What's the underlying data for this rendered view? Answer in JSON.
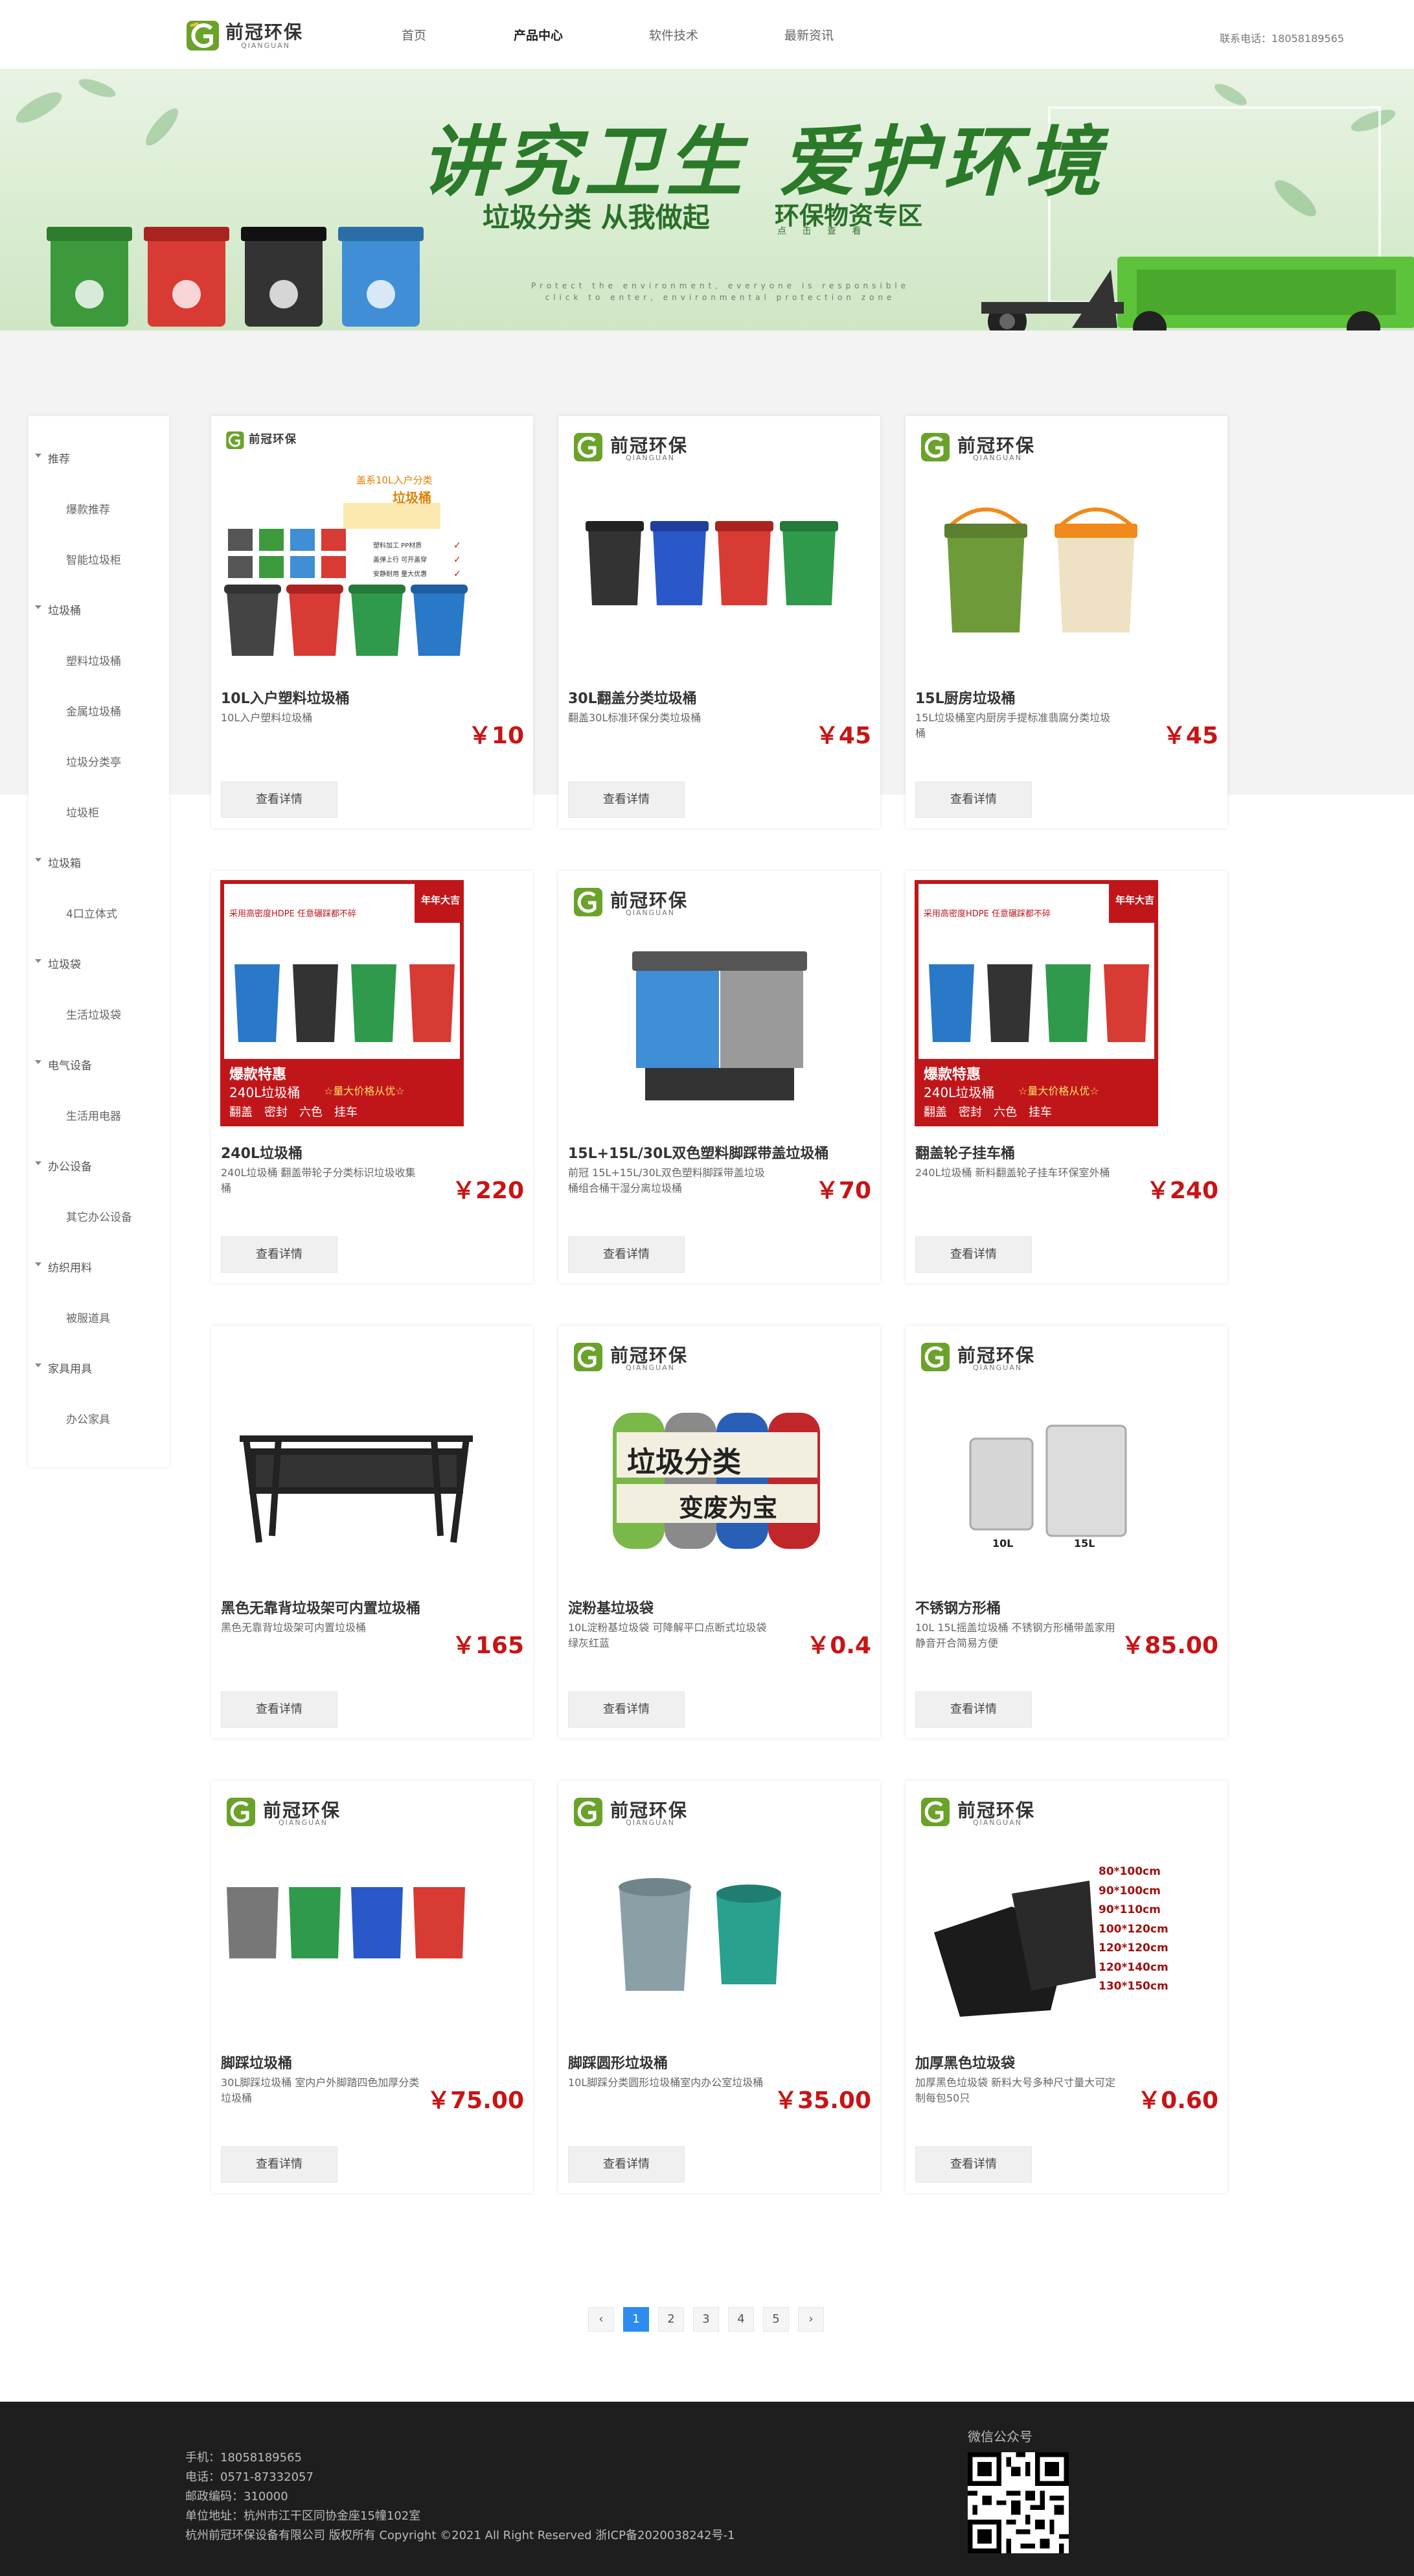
{
  "header": {
    "logo_cn": "前冠环保",
    "logo_en": "QIANGUAN",
    "nav": [
      "首页",
      "产品中心",
      "软件技术",
      "最新资讯"
    ],
    "active_nav": "产品中心",
    "phone": "联系电话：18058189565"
  },
  "banner": {
    "title": "讲究卫生 爱护环境",
    "sub1": "垃圾分类 从我做起",
    "sub2": "环保物资专区",
    "sub2_small": "点 击 查 看",
    "en_line1": "Protect the environment, everyone is responsible",
    "en_line2": "click to enter, environmental protection zone"
  },
  "sidebar": {
    "groups": [
      {
        "label": "推荐",
        "items": [
          "爆款推荐",
          "智能垃圾柜"
        ]
      },
      {
        "label": "垃圾桶",
        "items": [
          "塑料垃圾桶",
          "金属垃圾桶",
          "垃圾分类亭",
          "垃圾柜"
        ]
      },
      {
        "label": "垃圾箱",
        "items": [
          "4口立体式"
        ]
      },
      {
        "label": "垃圾袋",
        "items": [
          "生活垃圾袋"
        ]
      },
      {
        "label": "电气设备",
        "items": [
          "生活用电器"
        ]
      },
      {
        "label": "办公设备",
        "items": [
          "其它办公设备"
        ]
      },
      {
        "label": "纺织用料",
        "items": [
          "被服道具"
        ]
      },
      {
        "label": "家具用具",
        "items": [
          "办公家具"
        ]
      }
    ]
  },
  "products": [
    {
      "name": "10L入户塑料垃圾桶",
      "desc": "10L入户塑料垃圾桶",
      "price": "￥10",
      "button": "查看详情",
      "img_logo": "前冠环保",
      "img_caption1": "盖系10L入户分类",
      "img_caption2": "垃圾桶",
      "img_features": [
        "塑料加工 PP材质",
        "盖弹上行 可开盖穿",
        "安静耐用 量大优惠"
      ]
    },
    {
      "name": "30L翻盖分类垃圾桶",
      "desc": "翻盖30L标准环保分类垃圾桶",
      "price": "￥45",
      "button": "查看详情",
      "img_logo": "前冠环保"
    },
    {
      "name": "15L厨房垃圾桶",
      "desc": "15L垃圾桶室内厨房手提标准翡腐分类垃圾桶",
      "price": "￥45",
      "button": "查看详情",
      "img_logo": "前冠环保"
    },
    {
      "name": "240L垃圾桶",
      "desc": "240L垃圾桶 翻盖带轮子分类标识垃圾收集桶",
      "price": "￥220",
      "button": "查看详情",
      "img_badge": "年年大吉",
      "img_text1": "采用高密度HDPE 任意碾踩都不碎",
      "img_promo": "爆款特惠",
      "img_size": "240L垃圾桶",
      "img_deal": "☆量大价格从优☆",
      "img_tags": [
        "翻盖",
        "密封",
        "六色",
        "挂车"
      ]
    },
    {
      "name": "15L+15L/30L双色塑料脚踩带盖垃圾桶",
      "desc": "前冠 15L+15L/30L双色塑料脚踩带盖垃圾桶组合桶干湿分离垃圾桶",
      "price": "￥70",
      "button": "查看详情",
      "img_logo": "前冠环保"
    },
    {
      "name": "翻盖轮子挂车桶",
      "desc": "240L垃圾桶 新料翻盖轮子挂车环保室外桶",
      "price": "￥240",
      "button": "查看详情",
      "img_badge": "年年大吉",
      "img_text1": "采用高密度HDPE 任意碾踩都不碎",
      "img_promo": "爆款特惠",
      "img_size": "240L垃圾桶",
      "img_deal": "☆量大价格从优☆",
      "img_tags": [
        "翻盖",
        "密封",
        "六色",
        "挂车"
      ]
    },
    {
      "name": "黑色无靠背垃圾架可内置垃圾桶",
      "desc": "黑色无靠背垃圾架可内置垃圾桶",
      "price": "￥165",
      "button": "查看详情"
    },
    {
      "name": "淀粉基垃圾袋",
      "desc": "10L淀粉基垃圾袋 可降解平口点断式垃圾袋 绿灰红蓝",
      "price": "￥0.4",
      "button": "查看详情",
      "img_logo": "前冠环保",
      "img_word1": "垃圾分类",
      "img_word2": "变废为宝"
    },
    {
      "name": "不锈钢方形桶",
      "desc": "10L 15L摇盖垃圾桶 不锈钢方形桶带盖家用 静音开合简易方便",
      "price": "￥85.00",
      "button": "查看详情",
      "img_logo": "前冠环保",
      "img_labels": [
        "10L",
        "15L"
      ]
    },
    {
      "name": "脚踩垃圾桶",
      "desc": "30L脚踩垃圾桶 室内户外脚踏四色加厚分类垃圾桶",
      "price": "￥75.00",
      "button": "查看详情",
      "img_logo": "前冠环保"
    },
    {
      "name": "脚踩圆形垃圾桶",
      "desc": "10L脚踩分类圆形垃圾桶室内办公室垃圾桶",
      "price": "￥35.00",
      "button": "查看详情",
      "img_logo": "前冠环保"
    },
    {
      "name": "加厚黑色垃圾袋",
      "desc": "加厚黑色垃圾袋 新料大号多种尺寸量大可定制每包50只",
      "price": "￥0.60",
      "button": "查看详情",
      "img_logo": "前冠环保",
      "img_sizes": [
        "80*100cm",
        "90*100cm",
        "90*110cm",
        "100*120cm",
        "120*120cm",
        "120*140cm",
        "130*150cm"
      ]
    }
  ],
  "pagination": {
    "prev": "‹",
    "pages": [
      "1",
      "2",
      "3",
      "4",
      "5"
    ],
    "next": "›",
    "active": "1"
  },
  "footer": {
    "lines": [
      "手机：18058189565",
      "电话：0571-87332057",
      "邮政编码：310000",
      "单位地址：杭州市江干区同协金座15幢102室",
      "杭州前冠环保设备有限公司 版权所有 Copyright ©2021 All Right Reserved 浙ICP备2020038242号-1"
    ],
    "wechat_title": "微信公众号"
  },
  "colors": {
    "accent": "#2d8cf0",
    "price": "#c81414",
    "footer_bg": "#1e1e1e",
    "brand_green": "#6aa22a"
  }
}
